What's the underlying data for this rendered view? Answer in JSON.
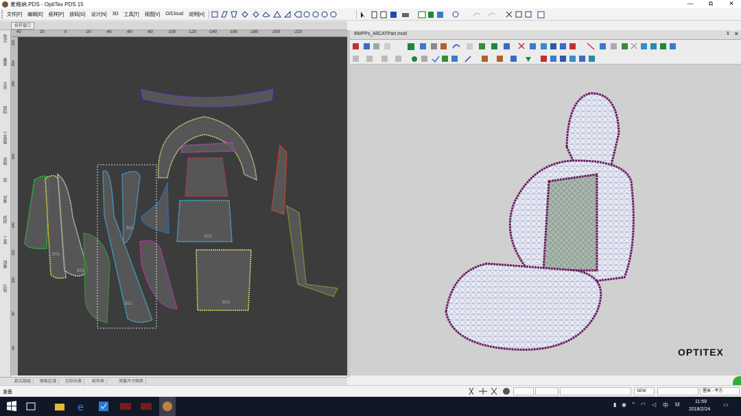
{
  "window": {
    "title": "麦格纳.PDS - OptiTex PDS 15",
    "minimize": "—",
    "restore": "⧉",
    "close": "✕"
  },
  "menu": [
    "文件[F]",
    "编辑[E]",
    "纸样[P]",
    "放码[G]",
    "设计[N]",
    "3D",
    "工具[T]",
    "视图[V]",
    "O/Cloud",
    "说明[H]"
  ],
  "left_pane": {
    "tab": "纸样窗口",
    "ruler_top": [
      "40",
      "20",
      "0",
      "-20",
      "-40",
      "-60",
      "-80",
      "-100",
      "-120",
      "-140",
      "-160",
      "-180",
      "-200",
      "-220"
    ],
    "ruler_left": [
      "220",
      "200",
      "180",
      "160",
      "140",
      "120",
      "100",
      "80",
      "60"
    ],
    "side_tabs": [
      "款式",
      "量度",
      "文件",
      "放码",
      "工具箱",
      "说明",
      "层",
      "对象",
      "纸样",
      "工具",
      "测量",
      "比较"
    ],
    "piece_label": "BS1",
    "bottom_tabs": [
      "款式副组",
      "面板区域",
      "比较长度",
      "纸样表",
      "测量尺寸图表"
    ]
  },
  "right_pane": {
    "title": "8WPPs_AllCATPart.mod",
    "pin": "⇕",
    "close": "✕",
    "brand": "OPTITEX"
  },
  "status": {
    "text": "准备",
    "sew": "SEW",
    "units": "厘米 - 平方"
  },
  "taskbar": {
    "time": "11:59",
    "date": "2018/2/24",
    "ime": "中",
    "ime2": "M"
  },
  "colors": {
    "canvas": "#3c3c3c",
    "viewport": "#d0d0d0",
    "mesh": "#6a1a5e",
    "taskbar": "#101828"
  }
}
